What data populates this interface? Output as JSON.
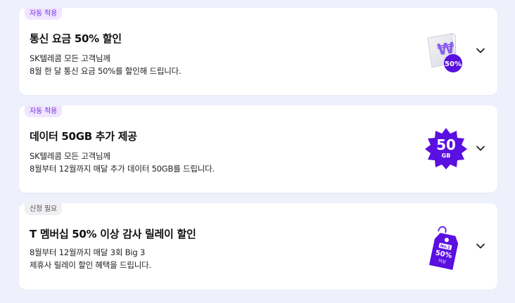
{
  "benefits": [
    {
      "badge": "자동 적용",
      "title": "통신 요금 50% 할인",
      "desc_line1": "SK텔레콤 모든 고객님께",
      "desc_line2": "8월 한 달 통신 요금 50%를 할인해 드립니다.",
      "icon": "won-receipt-50-icon",
      "icon_text": "50%",
      "icon_symbol": "₩"
    },
    {
      "badge": "자동 적용",
      "title": "데이터 50GB 추가 제공",
      "desc_line1": "SK텔레콤 모든 고객님께",
      "desc_line2": "8월부터 12월까지 매달 추가 데이터 50GB를 드립니다.",
      "icon": "data-50gb-badge-icon",
      "icon_text": "50",
      "icon_subtext": "GB"
    },
    {
      "badge": "신청 필요",
      "title": "T 멤버십 50% 이상 감사 릴레이 할인",
      "desc_line1": "8월부터 12월까지 매달 3회 Big 3",
      "desc_line2": "제휴사 릴레이 할인 혜택을 드립니다.",
      "icon": "discount-tag-icon",
      "icon_tag_top": "No.1",
      "icon_text": "50%",
      "icon_subtext": "이상"
    }
  ],
  "colors": {
    "background": "#eef1fb",
    "accent_purple": "#5a10e0",
    "badge_auto_bg": "#f0e6ff",
    "badge_auto_text": "#7a2ee0",
    "badge_apply_bg": "#f0f0f3"
  }
}
